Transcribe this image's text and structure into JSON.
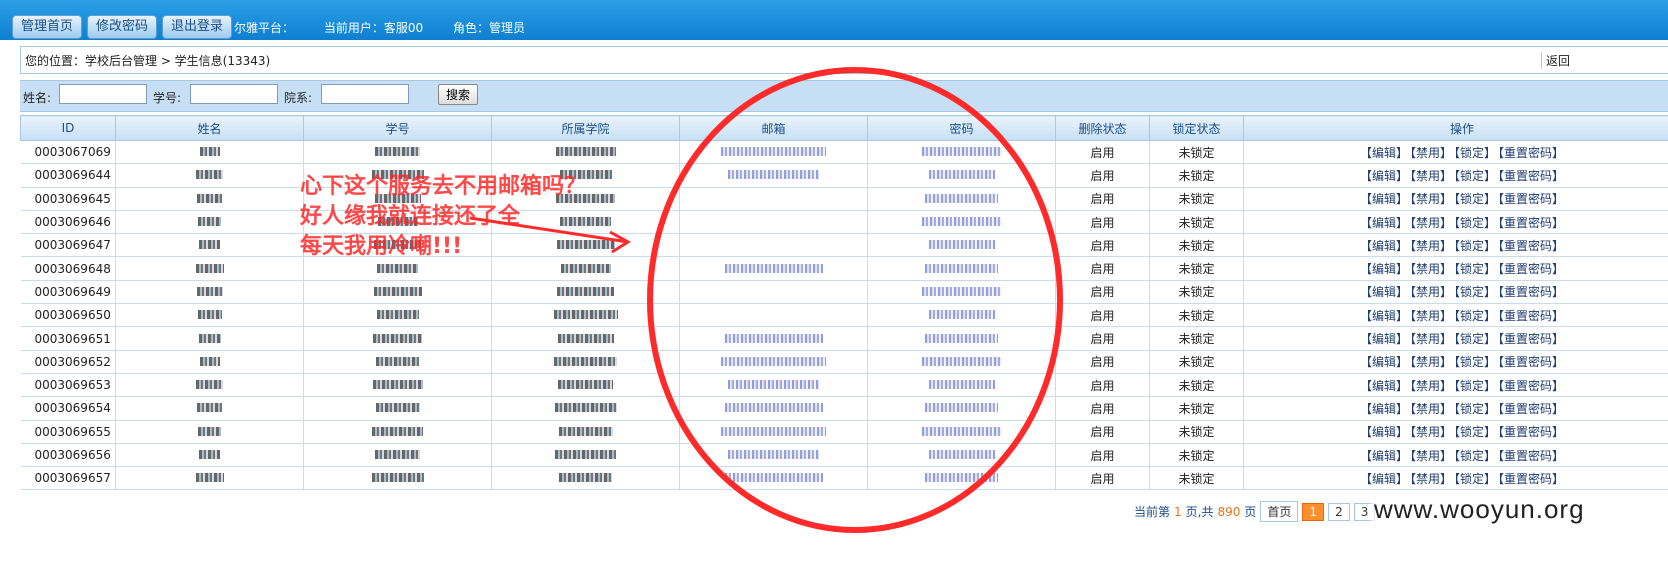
{
  "topnav": {
    "buttons": [
      "管理首页",
      "修改密码",
      "退出登录"
    ],
    "platform": "尔雅平台：",
    "current_user": "当前用户：客服00",
    "role": "角色：管理员"
  },
  "breadcrumb": {
    "text": "您的位置：学校后台管理 > 学生信息(13343)",
    "back": "返回"
  },
  "search": {
    "name_label": "姓名:",
    "id_label": "学号:",
    "dept_label": "院系:",
    "button": "搜索"
  },
  "table": {
    "headers": [
      "ID",
      "姓名",
      "学号",
      "所属学院",
      "邮箱",
      "密码",
      "删除状态",
      "锁定状态",
      "操作"
    ],
    "rows": [
      {
        "id": "0003067069",
        "del": "启用",
        "lock": "未锁定"
      },
      {
        "id": "0003069644",
        "del": "启用",
        "lock": "未锁定"
      },
      {
        "id": "0003069645",
        "del": "启用",
        "lock": "未锁定"
      },
      {
        "id": "0003069646",
        "del": "启用",
        "lock": "未锁定"
      },
      {
        "id": "0003069647",
        "del": "启用",
        "lock": "未锁定"
      },
      {
        "id": "0003069648",
        "del": "启用",
        "lock": "未锁定"
      },
      {
        "id": "0003069649",
        "del": "启用",
        "lock": "未锁定"
      },
      {
        "id": "0003069650",
        "del": "启用",
        "lock": "未锁定"
      },
      {
        "id": "0003069651",
        "del": "启用",
        "lock": "未锁定"
      },
      {
        "id": "0003069652",
        "del": "启用",
        "lock": "未锁定"
      },
      {
        "id": "0003069653",
        "del": "启用",
        "lock": "未锁定"
      },
      {
        "id": "0003069654",
        "del": "启用",
        "lock": "未锁定"
      },
      {
        "id": "0003069655",
        "del": "启用",
        "lock": "未锁定"
      },
      {
        "id": "0003069656",
        "del": "启用",
        "lock": "未锁定"
      },
      {
        "id": "0003069657",
        "del": "启用",
        "lock": "未锁定"
      }
    ],
    "ops": [
      "【编辑】",
      "【禁用】",
      "【锁定】",
      "【重置密码】"
    ]
  },
  "pager": {
    "current_prefix": "当前第",
    "current": "1",
    "total_prefix": "页,共",
    "total": "890",
    "total_suffix": "页",
    "first": "首页",
    "pages": [
      "1",
      "2",
      "3"
    ]
  },
  "watermark": "www.wooyun.org",
  "annotation": {
    "lines": [
      "心下这个服务去不用邮箱吗？",
      "好人缘我就连接还了全",
      "每天我用冷嘲!!!"
    ],
    "color": "#ff2a2a"
  }
}
